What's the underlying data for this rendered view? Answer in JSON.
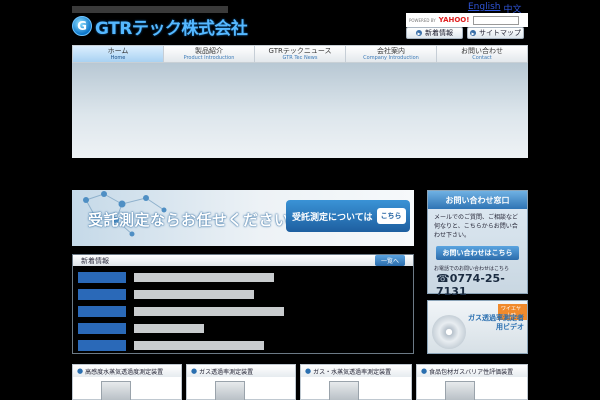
{
  "header": {
    "company_name": "GTRテック株式会社",
    "logo_letter": "G",
    "top_links": [
      "English",
      "中文"
    ],
    "search": {
      "powered_by": "POWERED BY",
      "engine": "YAHOO!"
    },
    "buttons": [
      "新着情報",
      "サイトマップ"
    ]
  },
  "nav": {
    "items": [
      {
        "jp": "ホーム",
        "en": "Home"
      },
      {
        "jp": "製品紹介",
        "en": "Product Introduction"
      },
      {
        "jp": "GTRテックニュース",
        "en": "GTR Tec News"
      },
      {
        "jp": "会社案内",
        "en": "Company Introduction"
      },
      {
        "jp": "お問い合わせ",
        "en": "Contact"
      }
    ]
  },
  "banner": {
    "text": "受託測定ならお任せください",
    "cta": "受託測定については",
    "cta_here": "こちら"
  },
  "news": {
    "title": "新着情報",
    "more": "一覧へ",
    "items": [
      {
        "date": "",
        "text": ""
      },
      {
        "date": "",
        "text": ""
      },
      {
        "date": "",
        "text": ""
      },
      {
        "date": "",
        "text": ""
      },
      {
        "date": "",
        "text": ""
      }
    ]
  },
  "sidebar": {
    "contact_title": "お問い合わせ窓口",
    "contact_body": "メールでのご質問、ご相談など何なりと、こちらからお問い合わせ下さい。",
    "contact_button": "お問い合わせはこちら",
    "tel_label": "お電話でのお問い合わせはこちら",
    "tel": "☎0774-25-7131",
    "video_ribbon": "ワイエヤー上映",
    "video_text": "ガス透過率測定者用ビデオ"
  },
  "products": [
    "高感度水蒸気透過度測定装置",
    "ガス透過率測定装置",
    "ガス・水蒸気透過率測定装置",
    "食品包材ガスバリア性評価装置"
  ]
}
